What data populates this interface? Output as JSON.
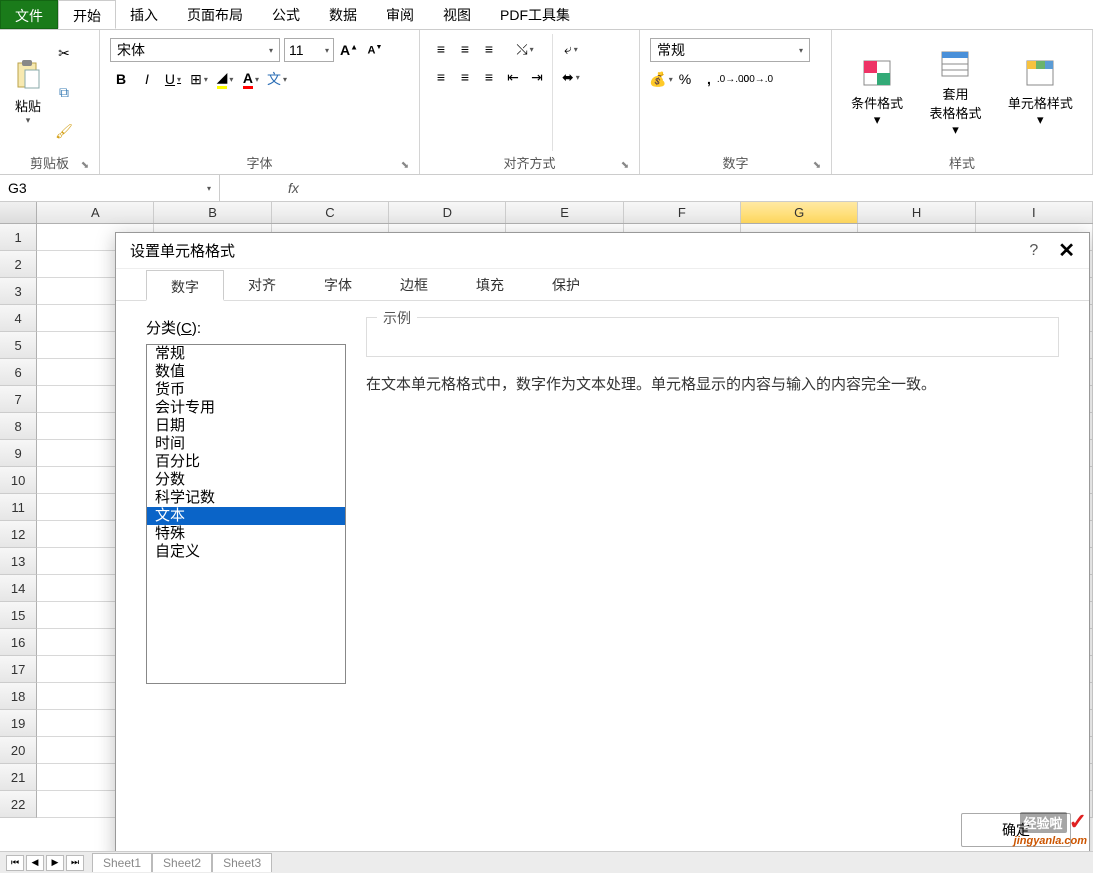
{
  "tabs": {
    "file": "文件",
    "home": "开始",
    "insert": "插入",
    "layout": "页面布局",
    "formula": "公式",
    "data": "数据",
    "review": "审阅",
    "view": "视图",
    "pdf": "PDF工具集"
  },
  "ribbon": {
    "clipboard": {
      "paste": "粘贴",
      "label": "剪贴板"
    },
    "font": {
      "name": "宋体",
      "size": "11",
      "label": "字体",
      "bold": "B",
      "italic": "I",
      "underline": "U"
    },
    "align": {
      "label": "对齐方式"
    },
    "number": {
      "format": "常规",
      "label": "数字",
      "percent": "%",
      "comma": ","
    },
    "styles": {
      "cond": "条件格式",
      "table": "套用\n表格格式",
      "cell": "单元格样式",
      "label": "样式"
    }
  },
  "namebox": "G3",
  "fx": "fx",
  "columns": [
    "A",
    "B",
    "C",
    "D",
    "E",
    "F",
    "G",
    "H",
    "I"
  ],
  "sel_col": "G",
  "rows": [
    "1",
    "2",
    "3",
    "4",
    "5",
    "6",
    "7",
    "8",
    "9",
    "10",
    "11",
    "12",
    "13",
    "14",
    "15",
    "16",
    "17",
    "18",
    "19",
    "20",
    "21",
    "22"
  ],
  "dialog": {
    "title": "设置单元格格式",
    "tabs": [
      "数字",
      "对齐",
      "字体",
      "边框",
      "填充",
      "保护"
    ],
    "active_tab": "数字",
    "cat_label_pre": "分类(",
    "cat_label_u": "C",
    "cat_label_post": "):",
    "categories": [
      "常规",
      "数值",
      "货币",
      "会计专用",
      "日期",
      "时间",
      "百分比",
      "分数",
      "科学记数",
      "文本",
      "特殊",
      "自定义"
    ],
    "selected": "文本",
    "example_label": "示例",
    "description": "在文本单元格格式中，数字作为文本处理。单元格显示的内容与输入的内容完全一致。",
    "ok": "确定",
    "help": "?",
    "close": "✕"
  },
  "sheets": [
    "Sheet1",
    "Sheet2",
    "Sheet3"
  ],
  "watermark": {
    "top": "经验啦",
    "check": "✓",
    "bottom": "jingyanla.com"
  }
}
